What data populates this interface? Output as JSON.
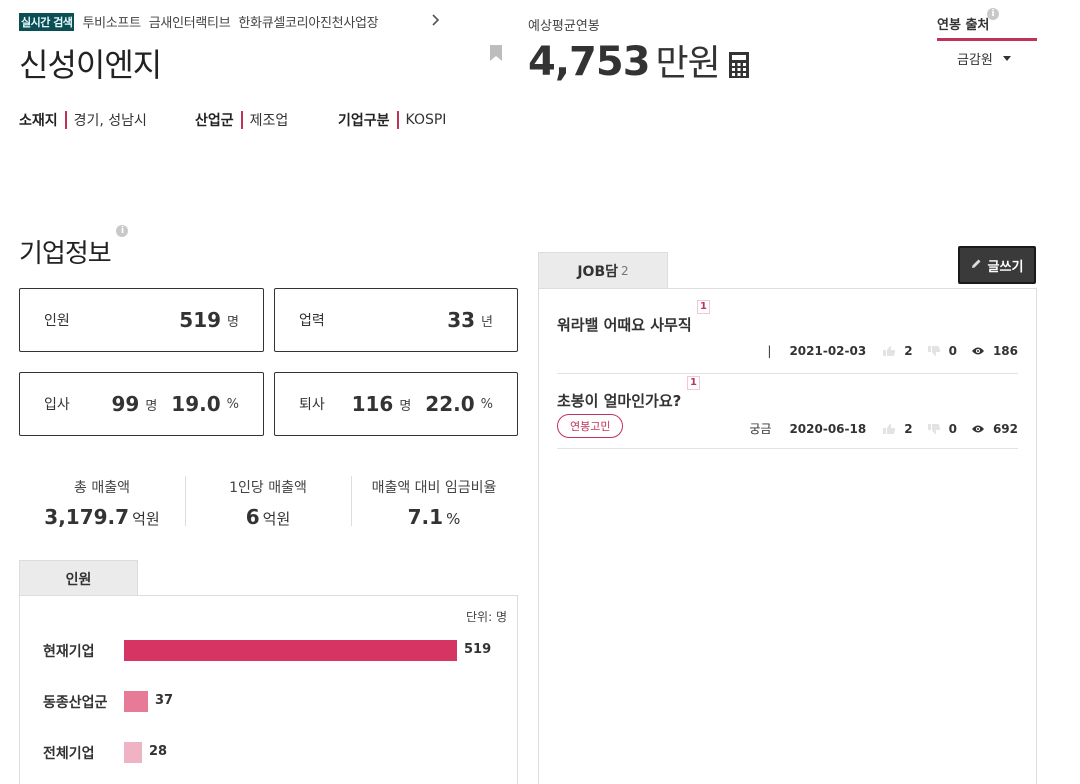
{
  "ticker": {
    "badge": "실시간 검색",
    "items": [
      "투비소프트",
      "금새인터랙티브",
      "한화큐셀코리아진천사업장"
    ]
  },
  "company": {
    "name": "신성이엔지",
    "location_key": "소재지",
    "location": "경기, 성남시",
    "industry_key": "산업군",
    "industry": "제조업",
    "type_key": "기업구분",
    "type": "KOSPI"
  },
  "salary": {
    "label": "예상평균연봉",
    "value": "4,753",
    "unit": "만원",
    "source_title": "연봉 출처",
    "source_selected": "금감원"
  },
  "info_icon_glyph": "i",
  "company_info": {
    "title": "기업정보",
    "employees": {
      "label": "인원",
      "value": "519",
      "unit": "명"
    },
    "years": {
      "label": "업력",
      "value": "33",
      "unit": "년"
    },
    "hires": {
      "label": "입사",
      "value": "99",
      "unit": "명",
      "pct": "19.0",
      "pct_unit": "%"
    },
    "leaves": {
      "label": "퇴사",
      "value": "116",
      "unit": "명",
      "pct": "22.0",
      "pct_unit": "%"
    },
    "revenue_total": {
      "label": "총 매출액",
      "value": "3,179.7",
      "unit": "억원"
    },
    "revenue_per": {
      "label": "1인당 매출액",
      "value": "6",
      "unit": "억원"
    },
    "wage_ratio": {
      "label": "매출액 대비 임금비율",
      "value": "7.1",
      "unit": "%"
    }
  },
  "chart_tab": "인원",
  "chart_data": {
    "type": "bar",
    "orientation": "horizontal",
    "unit_label": "단위: 명",
    "categories": [
      "현재기업",
      "동종산업군",
      "전체기업"
    ],
    "values": [
      519,
      37,
      28
    ],
    "colors": [
      "#d63564",
      "#e77a96",
      "#f0b3c4"
    ]
  },
  "job": {
    "tab_label": "JOB담",
    "tab_count": "2",
    "write_label": "글쓰기",
    "posts": [
      {
        "title": "워라밸 어때요 사무직",
        "badge": "1",
        "category": "",
        "sep": "|",
        "date": "2021-02-03",
        "likes": "2",
        "dislikes": "0",
        "views": "186",
        "tag": ""
      },
      {
        "title": "초봉이 얼마인가요?",
        "badge": "1",
        "category": "궁금",
        "sep": "",
        "date": "2020-06-18",
        "likes": "2",
        "dislikes": "0",
        "views": "692",
        "tag": "연봉고민"
      }
    ]
  },
  "colors": {
    "accent": "#c0325a",
    "ticker_badge": "#0b4f55",
    "button_dark": "#3a3a3a"
  }
}
